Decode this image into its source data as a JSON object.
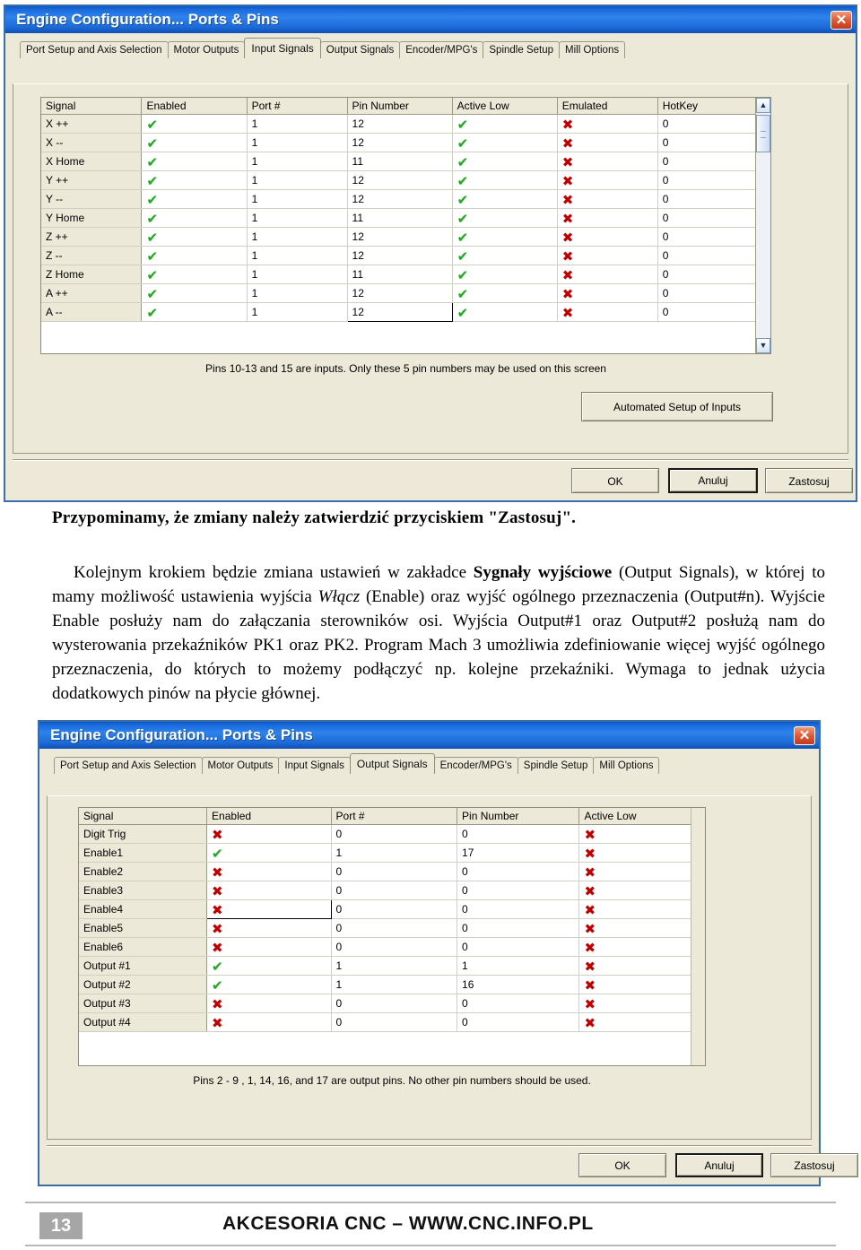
{
  "dialog1": {
    "title": "Engine Configuration... Ports & Pins",
    "close_label": "✕",
    "tabs": [
      {
        "label": "Port Setup and Axis Selection",
        "active": false
      },
      {
        "label": "Motor Outputs",
        "active": false
      },
      {
        "label": "Input Signals",
        "active": true
      },
      {
        "label": "Output Signals",
        "active": false
      },
      {
        "label": "Encoder/MPG's",
        "active": false
      },
      {
        "label": "Spindle Setup",
        "active": false
      },
      {
        "label": "Mill Options",
        "active": false
      }
    ],
    "table": {
      "columns": [
        "Signal",
        "Enabled",
        "Port #",
        "Pin Number",
        "Active Low",
        "Emulated",
        "HotKey"
      ],
      "rows": [
        {
          "signal": "X ++",
          "enabled": "check",
          "port": "1",
          "pin": "12",
          "active_low": "check",
          "emulated": "cross",
          "hotkey": "0"
        },
        {
          "signal": "X --",
          "enabled": "check",
          "port": "1",
          "pin": "12",
          "active_low": "check",
          "emulated": "cross",
          "hotkey": "0"
        },
        {
          "signal": "X Home",
          "enabled": "check",
          "port": "1",
          "pin": "11",
          "active_low": "check",
          "emulated": "cross",
          "hotkey": "0"
        },
        {
          "signal": "Y ++",
          "enabled": "check",
          "port": "1",
          "pin": "12",
          "active_low": "check",
          "emulated": "cross",
          "hotkey": "0"
        },
        {
          "signal": "Y --",
          "enabled": "check",
          "port": "1",
          "pin": "12",
          "active_low": "check",
          "emulated": "cross",
          "hotkey": "0"
        },
        {
          "signal": "Y Home",
          "enabled": "check",
          "port": "1",
          "pin": "11",
          "active_low": "check",
          "emulated": "cross",
          "hotkey": "0"
        },
        {
          "signal": "Z ++",
          "enabled": "check",
          "port": "1",
          "pin": "12",
          "active_low": "check",
          "emulated": "cross",
          "hotkey": "0"
        },
        {
          "signal": "Z --",
          "enabled": "check",
          "port": "1",
          "pin": "12",
          "active_low": "check",
          "emulated": "cross",
          "hotkey": "0"
        },
        {
          "signal": "Z Home",
          "enabled": "check",
          "port": "1",
          "pin": "11",
          "active_low": "check",
          "emulated": "cross",
          "hotkey": "0"
        },
        {
          "signal": "A ++",
          "enabled": "check",
          "port": "1",
          "pin": "12",
          "active_low": "check",
          "emulated": "cross",
          "hotkey": "0"
        },
        {
          "signal": "A --",
          "enabled": "check",
          "port": "1",
          "pin": "12",
          "active_low": "check",
          "emulated": "cross",
          "hotkey": "0",
          "pin_selected": true
        }
      ]
    },
    "hint": "Pins 10-13 and 15 are inputs. Only these 5 pin numbers may be used on this screen",
    "automated_button": "Automated Setup of Inputs",
    "buttons": {
      "ok": "OK",
      "cancel": "Anuluj",
      "apply": "Zastosuj"
    },
    "scroll_up_icon": "▲",
    "scroll_down_icon": "▼"
  },
  "article": {
    "lead": "Przypominamy, że zmiany należy zatwierdzić przyciskiem \"Zastosuj\".",
    "paragraph": {
      "p1": "Kolejnym krokiem będzie zmiana ustawień w zakładce ",
      "b1": "Sygnały wyjściowe",
      "p2": " (Output Signals), w której to mamy możliwość ustawienia wyjścia ",
      "i1": "Włącz",
      "p3": " (Enable) oraz wyjść ogólnego przeznaczenia (Output#n). Wyjście Enable posłuży nam do załączania sterowników osi. Wyjścia Output#1 oraz Output#2 posłużą nam do wysterowania przekaźników PK1 oraz PK2. Program Mach 3 umożliwia zdefiniowanie więcej wyjść ogólnego przeznaczenia, do których to możemy podłączyć np. kolejne przekaźniki. Wymaga to jednak użycia dodatkowych pinów na płycie głównej."
    }
  },
  "dialog2": {
    "title": "Engine Configuration... Ports & Pins",
    "close_label": "✕",
    "tabs": [
      {
        "label": "Port Setup and Axis Selection",
        "active": false
      },
      {
        "label": "Motor Outputs",
        "active": false
      },
      {
        "label": "Input Signals",
        "active": false
      },
      {
        "label": "Output Signals",
        "active": true
      },
      {
        "label": "Encoder/MPG's",
        "active": false
      },
      {
        "label": "Spindle Setup",
        "active": false
      },
      {
        "label": "Mill Options",
        "active": false
      }
    ],
    "table": {
      "columns": [
        "Signal",
        "Enabled",
        "Port #",
        "Pin Number",
        "Active Low"
      ],
      "rows": [
        {
          "signal": "Digit  Trig",
          "enabled": "cross",
          "port": "0",
          "pin": "0",
          "active_low": "cross"
        },
        {
          "signal": "Enable1",
          "enabled": "check",
          "port": "1",
          "pin": "17",
          "active_low": "cross"
        },
        {
          "signal": "Enable2",
          "enabled": "cross",
          "port": "0",
          "pin": "0",
          "active_low": "cross"
        },
        {
          "signal": "Enable3",
          "enabled": "cross",
          "port": "0",
          "pin": "0",
          "active_low": "cross"
        },
        {
          "signal": "Enable4",
          "enabled": "cross",
          "port": "0",
          "pin": "0",
          "active_low": "cross",
          "enabled_selected": true
        },
        {
          "signal": "Enable5",
          "enabled": "cross",
          "port": "0",
          "pin": "0",
          "active_low": "cross"
        },
        {
          "signal": "Enable6",
          "enabled": "cross",
          "port": "0",
          "pin": "0",
          "active_low": "cross"
        },
        {
          "signal": "Output #1",
          "enabled": "check",
          "port": "1",
          "pin": "1",
          "active_low": "cross"
        },
        {
          "signal": "Output #2",
          "enabled": "check",
          "port": "1",
          "pin": "16",
          "active_low": "cross"
        },
        {
          "signal": "Output #3",
          "enabled": "cross",
          "port": "0",
          "pin": "0",
          "active_low": "cross"
        },
        {
          "signal": "Output #4",
          "enabled": "cross",
          "port": "0",
          "pin": "0",
          "active_low": "cross"
        }
      ]
    },
    "hint": "Pins 2 - 9 , 1, 14, 16, and 17 are output pins. No  other pin numbers should be used.",
    "buttons": {
      "ok": "OK",
      "cancel": "Anuluj",
      "apply": "Zastosuj"
    }
  },
  "footer": {
    "page_number": "13",
    "text": "AKCESORIA CNC – WWW.CNC.INFO.PL"
  },
  "colors": {
    "titlebar_blue": "#1b6bdc",
    "dialog_face": "#ece9d8",
    "check_green": "#22aa22",
    "cross_red": "#c00000",
    "page_badge_gray": "#a6a6a6"
  }
}
